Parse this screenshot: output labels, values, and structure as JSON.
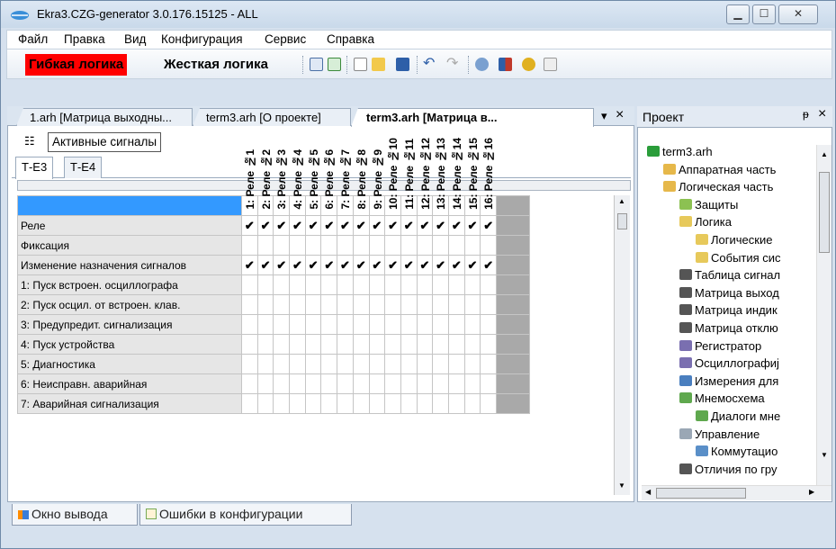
{
  "window": {
    "title": "Ekra3.CZG-generator 3.0.176.15125 - ALL"
  },
  "menu": [
    "Файл",
    "Правка",
    "Вид",
    "Конфигурация",
    "Сервис",
    "Справка"
  ],
  "toolbar": {
    "flexible": "Гибкая логика",
    "hard": "Жесткая логика",
    "accent_red": "#ff0000"
  },
  "doc_tabs": [
    "1.arh [Матрица выходны...",
    "term3.arh [О проекте]",
    "term3.arh [Матрица в..."
  ],
  "doc_tab_controls": {
    "pin": "▾",
    "close": "×"
  },
  "signals_button": "Активные сигналы",
  "e_tabs": [
    "Т-Е3",
    "Т-Е4"
  ],
  "columns": [
    "1: Реле №1",
    "2: Реле №2",
    "3: Реле №3",
    "4: Реле №4",
    "5: Реле №5",
    "6: Реле №6",
    "7: Реле №7",
    "8: Реле №8",
    "9: Реле №9",
    "10: Реле №10",
    "11: Реле №11",
    "12: Реле №12",
    "13: Реле №13",
    "14: Реле №14",
    "15: Реле №15",
    "16: Реле №16"
  ],
  "rows": [
    {
      "label": "Реле",
      "checks": true
    },
    {
      "label": "Фиксация",
      "checks": false
    },
    {
      "label": "Изменение назначения сигналов",
      "checks": true
    },
    {
      "label": "1: Пуск встроен. осциллографа",
      "checks": false
    },
    {
      "label": "2: Пуск осцил. от встроен. клав.",
      "checks": false
    },
    {
      "label": "3: Предупредит. сигнализация",
      "checks": false
    },
    {
      "label": "4: Пуск устройства",
      "checks": false
    },
    {
      "label": "5: Диагностика",
      "checks": false
    },
    {
      "label": "6: Неисправн. аварийная",
      "checks": false
    },
    {
      "label": "7: Аварийная сигнализация",
      "checks": false
    }
  ],
  "check_glyph": "✔",
  "project": {
    "title": "Проект",
    "pin": "ᵽ",
    "close": "×",
    "tree": [
      {
        "label": "term3.arh",
        "icon": "project-icon",
        "x": 0
      },
      {
        "label": "Аппаратная часть",
        "icon": "folder-icon",
        "x": 1
      },
      {
        "label": "Логическая часть",
        "icon": "folder-open-icon",
        "x": 1
      },
      {
        "label": "Защиты",
        "icon": "shield-icon",
        "x": 2
      },
      {
        "label": "Логика",
        "icon": "logic-icon",
        "x": 2
      },
      {
        "label": "Логические",
        "icon": "logic-icon",
        "x": 3
      },
      {
        "label": "События сис",
        "icon": "logic-icon",
        "x": 3
      },
      {
        "label": "Таблица сигнал",
        "icon": "grid-icon",
        "x": 2
      },
      {
        "label": "Матрица выход",
        "icon": "grid-icon",
        "x": 2
      },
      {
        "label": "Матрица индик",
        "icon": "grid-icon",
        "x": 2
      },
      {
        "label": "Матрица отклю",
        "icon": "grid-icon",
        "x": 2
      },
      {
        "label": "Регистратор",
        "icon": "recorder-icon",
        "x": 2
      },
      {
        "label": "Осциллографиј",
        "icon": "recorder-icon",
        "x": 2
      },
      {
        "label": "Измерения для",
        "icon": "measure-icon",
        "x": 2
      },
      {
        "label": "Мнемосхема",
        "icon": "mnemo-icon",
        "x": 2
      },
      {
        "label": "Диалоги мне",
        "icon": "mnemo-icon",
        "x": 3
      },
      {
        "label": "Управление",
        "icon": "control-icon",
        "x": 2
      },
      {
        "label": "Коммутацио",
        "icon": "switch-icon",
        "x": 3
      },
      {
        "label": "Отличия по гру",
        "icon": "grid-icon",
        "x": 2
      }
    ]
  },
  "bottom_tabs": [
    "Окно вывода",
    "Ошибки в конфигурации"
  ]
}
